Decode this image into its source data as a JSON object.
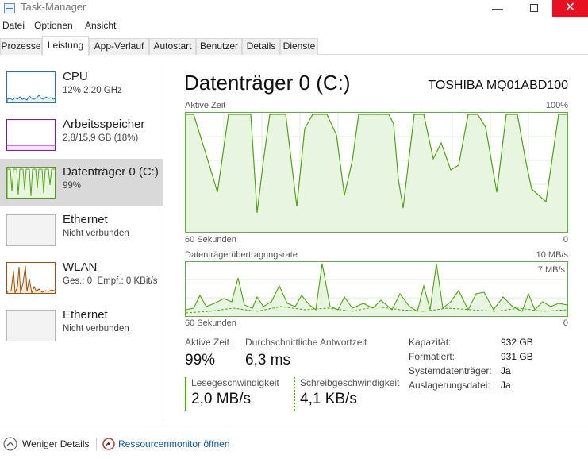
{
  "window": {
    "title": "Task-Manager",
    "minimize_glyph": "—",
    "close_glyph": "✕"
  },
  "menu": [
    "Datei",
    "Optionen",
    "Ansicht"
  ],
  "tabs": [
    "Prozesse",
    "Leistung",
    "App-Verlauf",
    "Autostart",
    "Benutzer",
    "Details",
    "Dienste"
  ],
  "active_tab": "Leistung",
  "sidebar": [
    {
      "name": "CPU",
      "sub": "12% 2,20 GHz",
      "color": "#1779ba"
    },
    {
      "name": "Arbeitsspeicher",
      "sub": "2,8/15,9 GB (18%)",
      "color": "#8b12ae"
    },
    {
      "name": "Datenträger 0 (C:)",
      "sub": "99%",
      "color": "#4da60c"
    },
    {
      "name": "Ethernet",
      "sub": "Nicht verbunden",
      "color": "#b8b8b8"
    },
    {
      "name": "WLAN",
      "sub_prefix1": "Ges.: ",
      "sub_val1": "0",
      "sub_prefix2": "  Empf.: ",
      "sub_val2": "0 KBit/s",
      "color": "#a74f01"
    },
    {
      "name": "Ethernet",
      "sub": "Nicht verbunden",
      "color": "#b8b8b8"
    }
  ],
  "main": {
    "title": "Datenträger 0 (C:)",
    "model": "TOSHIBA MQ01ABD100",
    "graph1": {
      "label": "Aktive Zeit",
      "max": "100%",
      "time": "60 Sekunden",
      "min": "0"
    },
    "graph2": {
      "label": "Datenträgerübertragungsrate",
      "max": "10 MB/s",
      "inner_max": "7 MB/s",
      "time": "60 Sekunden",
      "min": "0"
    },
    "stats": {
      "active_label": "Aktive Zeit",
      "active_value": "99%",
      "resp_label": "Durchschnittliche Antwortzeit",
      "resp_value": "6,3 ms",
      "read_label": "Lesegeschwindigkeit",
      "read_value": "2,0 MB/s",
      "write_label": "Schreibgeschwindigkeit",
      "write_value": "4,1 KB/s"
    },
    "props": [
      {
        "key": "Kapazität:",
        "value": "932 GB"
      },
      {
        "key": "Formatiert:",
        "value": "931 GB"
      },
      {
        "key": "Systemdatenträger:",
        "value": "Ja"
      },
      {
        "key": "Auslagerungsdatei:",
        "value": "Ja"
      }
    ]
  },
  "footer": {
    "less_details": "Weniger Details",
    "resmon": "Ressourcenmonitor öffnen"
  },
  "colors": {
    "disk": "#4da60c",
    "disk_fill": "#e8f5e1",
    "close": "#e81123"
  }
}
